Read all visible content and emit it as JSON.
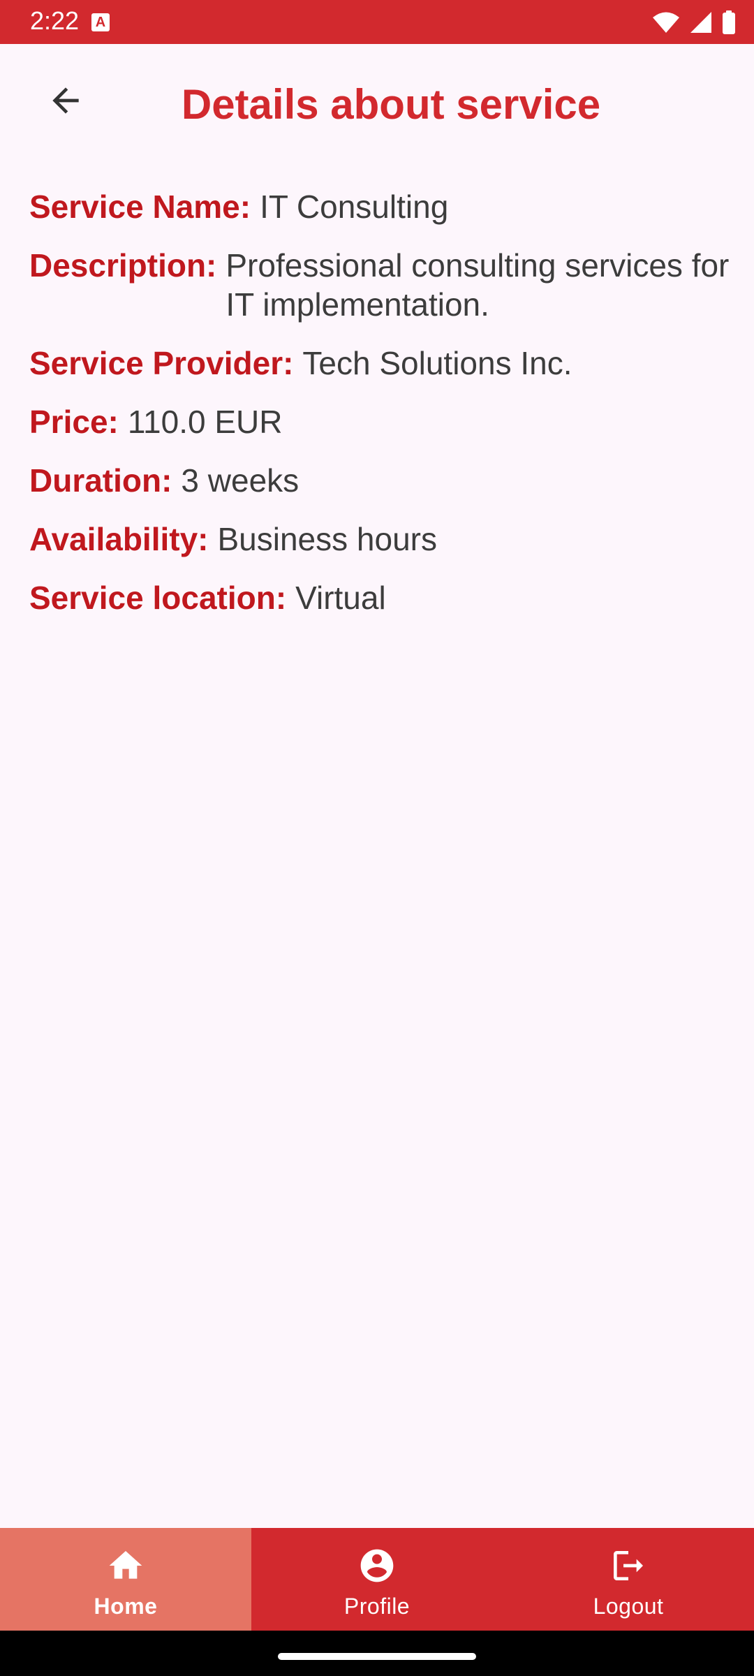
{
  "status_bar": {
    "time": "2:22",
    "notification_icon": "a-badge-icon",
    "notification_letter": "A",
    "icons": [
      "wifi-icon",
      "signal-icon",
      "battery-icon"
    ],
    "background": "#D2292E"
  },
  "header": {
    "back_icon": "arrow-left-icon",
    "title": "Details about service",
    "title_color": "#D2292E"
  },
  "details": [
    {
      "label": "Service Name:",
      "value": "IT Consulting"
    },
    {
      "label": "Description:",
      "value": "Professional consulting services for IT implementation."
    },
    {
      "label": "Service Provider:",
      "value": "Tech Solutions Inc."
    },
    {
      "label": "Price:",
      "value": "110.0 EUR"
    },
    {
      "label": "Duration:",
      "value": "3 weeks"
    },
    {
      "label": "Availability:",
      "value": "Business hours"
    },
    {
      "label": "Service location:",
      "value": "Virtual"
    }
  ],
  "bottom_nav": {
    "background": "#D2292E",
    "active_background": "#E57464",
    "items": [
      {
        "label": "Home",
        "icon": "home-icon",
        "active": true
      },
      {
        "label": "Profile",
        "icon": "account-circle-icon",
        "active": false
      },
      {
        "label": "Logout",
        "icon": "logout-icon",
        "active": false
      }
    ]
  }
}
